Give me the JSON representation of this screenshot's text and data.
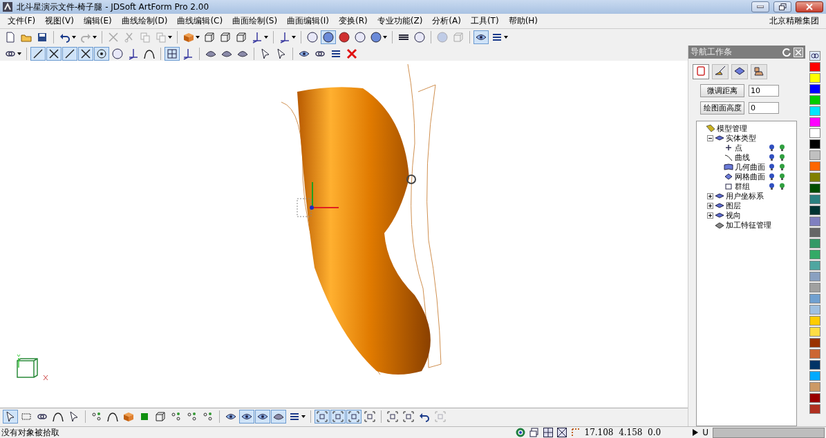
{
  "window": {
    "title": "北斗星演示文件-椅子腿 - JDSoft ArtForm Pro 2.00"
  },
  "menu": {
    "items": [
      "文件(F)",
      "视图(V)",
      "编辑(E)",
      "曲线绘制(D)",
      "曲线编辑(C)",
      "曲面绘制(S)",
      "曲面编辑(I)",
      "变换(R)",
      "专业功能(Z)",
      "分析(A)",
      "工具(T)",
      "帮助(H)"
    ],
    "company": "北京精雕集团"
  },
  "toolbars": [
    {
      "buttons": [
        {
          "selected": false,
          "disabled": false
        },
        {
          "selected": false,
          "disabled": false
        },
        {
          "selected": false,
          "disabled": false
        },
        {
          "selected": false,
          "disabled": false,
          "dropdown": true
        },
        {
          "selected": false,
          "disabled": true,
          "dropdown": true
        },
        {
          "selected": false,
          "disabled": true
        },
        {
          "selected": false,
          "disabled": true
        },
        {
          "selected": false,
          "disabled": true
        },
        {
          "selected": false,
          "disabled": true,
          "dropdown": true
        },
        {
          "selected": false,
          "disabled": false,
          "dropdown": true
        },
        {
          "selected": false,
          "disabled": false
        },
        {
          "selected": false,
          "disabled": false
        },
        {
          "selected": false,
          "disabled": false
        },
        {
          "selected": false,
          "disabled": false,
          "dropdown": true
        },
        {
          "selected": false,
          "disabled": false,
          "dropdown": true
        },
        {
          "selected": false,
          "disabled": false
        },
        {
          "selected": true,
          "disabled": false
        },
        {
          "selected": false,
          "disabled": false
        },
        {
          "selected": false,
          "disabled": false
        },
        {
          "selected": false,
          "disabled": false,
          "dropdown": true
        },
        {
          "selected": false,
          "disabled": false
        },
        {
          "selected": false,
          "disabled": false
        },
        {
          "selected": false,
          "disabled": true
        },
        {
          "selected": false,
          "disabled": true
        },
        {
          "selected": true,
          "disabled": false
        },
        {
          "selected": false,
          "disabled": false,
          "dropdown": true
        }
      ]
    },
    {
      "buttons": [
        {
          "selected": false,
          "dropdown": true
        },
        {
          "selected": true
        },
        {
          "selected": true
        },
        {
          "selected": true
        },
        {
          "selected": true
        },
        {
          "selected": true
        },
        {
          "selected": false
        },
        {
          "selected": false
        },
        {
          "selected": false
        },
        {
          "selected": true
        },
        {
          "selected": false
        },
        {
          "selected": false
        },
        {
          "selected": false
        },
        {
          "selected": false
        },
        {
          "selected": false
        },
        {
          "selected": false
        },
        {
          "selected": false
        },
        {
          "selected": false
        },
        {
          "selected": false
        },
        {
          "selected": false
        }
      ]
    },
    {
      "buttons": [
        {
          "selected": true
        },
        {
          "selected": false
        },
        {
          "selected": false
        },
        {
          "selected": false
        },
        {
          "selected": false
        },
        {
          "selected": false
        },
        {
          "selected": false
        },
        {
          "selected": false
        },
        {
          "selected": false
        },
        {
          "selected": false
        },
        {
          "selected": false
        },
        {
          "selected": false
        },
        {
          "selected": false
        },
        {
          "selected": false
        },
        {
          "selected": true
        },
        {
          "selected": true
        },
        {
          "selected": true
        },
        {
          "selected": false,
          "dropdown": true
        },
        {
          "selected": true
        },
        {
          "selected": true
        },
        {
          "selected": true
        },
        {
          "selected": false
        },
        {
          "selected": false
        },
        {
          "selected": false
        },
        {
          "selected": false
        },
        {
          "selected": false,
          "disabled": true
        }
      ]
    }
  ],
  "nav_panel": {
    "title": "导航工作条",
    "tabs": [
      {
        "selected": true
      },
      {
        "selected": false
      },
      {
        "selected": false
      },
      {
        "selected": false
      }
    ],
    "fields": [
      {
        "button": "微调距离",
        "value": "10"
      },
      {
        "button": "绘图面高度",
        "value": "0"
      }
    ],
    "tree": [
      {
        "label": "模型管理",
        "kind": "root",
        "children": [
          {
            "label": "实体类型",
            "kind": "folder",
            "expanded": true,
            "children": [
              {
                "label": "点",
                "kind": "entity"
              },
              {
                "label": "曲线",
                "kind": "entity"
              },
              {
                "label": "几何曲面",
                "kind": "entity"
              },
              {
                "label": "网格曲面",
                "kind": "entity"
              },
              {
                "label": "群组",
                "kind": "entity"
              }
            ]
          },
          {
            "label": "用户坐标系",
            "kind": "folder",
            "expanded": false
          },
          {
            "label": "图层",
            "kind": "folder",
            "expanded": false
          },
          {
            "label": "视向",
            "kind": "folder",
            "expanded": false
          },
          {
            "label": "加工特征管理",
            "kind": "item"
          }
        ]
      }
    ]
  },
  "palette": [
    {
      "color": "#ff0000"
    },
    {
      "color": "#ffff00"
    },
    {
      "color": "#0000ff"
    },
    {
      "color": "#00cc00"
    },
    {
      "color": "#00e5ff"
    },
    {
      "color": "#ff00ff"
    },
    {
      "color": "#ffffff"
    },
    {
      "color": "#000000"
    },
    {
      "color": "#c0c0c0"
    },
    {
      "color": "#ff6600"
    },
    {
      "color": "#808000"
    },
    {
      "color": "#004d00"
    },
    {
      "color": "#2a8080"
    },
    {
      "color": "#003333"
    },
    {
      "color": "#7f7fbf"
    },
    {
      "color": "#666666"
    },
    {
      "color": "#339966"
    },
    {
      "color": "#33aa66"
    },
    {
      "color": "#4fa6a0"
    },
    {
      "color": "#8aa0c0"
    },
    {
      "color": "#a0a0a0"
    },
    {
      "color": "#70a0d0"
    },
    {
      "color": "#a0c0e0"
    },
    {
      "color": "#ffcc00"
    },
    {
      "color": "#ffdd44"
    },
    {
      "color": "#993300"
    },
    {
      "color": "#cc6633"
    },
    {
      "color": "#003366"
    },
    {
      "color": "#00aaff"
    },
    {
      "color": "#cc9966"
    },
    {
      "color": "#990000"
    },
    {
      "color": "#b03020"
    }
  ],
  "status_bar": {
    "message": "没有对象被拾取",
    "coordinates": "17.108  4.158  0.0",
    "unit": "U"
  }
}
